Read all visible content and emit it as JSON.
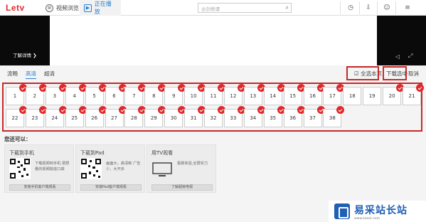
{
  "header": {
    "logo": "Letv",
    "tab_browse": "视频浏览",
    "tab_playing": "正在播放",
    "search_placeholder": "古剑奇谭"
  },
  "player": {
    "detail_link": "了解详情"
  },
  "quality": {
    "options": [
      "流畅",
      "高清",
      "超清"
    ],
    "active": "高清"
  },
  "actions": {
    "select_all": "全选本页",
    "download_selected": "下载选中",
    "cancel": "取消"
  },
  "episodes": [
    "1",
    "2",
    "3",
    "4",
    "5",
    "6",
    "7",
    "8",
    "9",
    "10",
    "11",
    "12",
    "13",
    "14",
    "15",
    "16",
    "17",
    "18",
    "19",
    "20",
    "21",
    "22",
    "23",
    "24",
    "25",
    "26",
    "27",
    "28",
    "29",
    "30",
    "31",
    "32",
    "33",
    "34",
    "35",
    "36",
    "37",
    "38"
  ],
  "episodes_checked": [
    1,
    2,
    3,
    4,
    5,
    6,
    7,
    8,
    9,
    10,
    11,
    12,
    13,
    14,
    15,
    16,
    17,
    20,
    21,
    22,
    23,
    24,
    25,
    26,
    27,
    28,
    29,
    30,
    31,
    32,
    33,
    34,
    35,
    36,
    37,
    38
  ],
  "notice": "您还可以：",
  "cards": [
    {
      "title": "下载到手机",
      "desc": "下载视频到手机 把想看的视频揣进口袋",
      "button": "安装手机客户端观看"
    },
    {
      "title": "下载到Pad",
      "desc": "画面大，高清晰 广告少，大开多",
      "button": "安装Pad客户端观看"
    },
    {
      "title": "用TV观看",
      "desc": "极致体验,全屏实力",
      "button": "了解超级电视"
    }
  ],
  "watermark": {
    "line1": "易采站长站",
    "line2": "www.easck.com"
  },
  "colors": {
    "accent_red": "#e0282b",
    "link_blue": "#2a7fd0",
    "highlight_box": "#c42a2a"
  }
}
